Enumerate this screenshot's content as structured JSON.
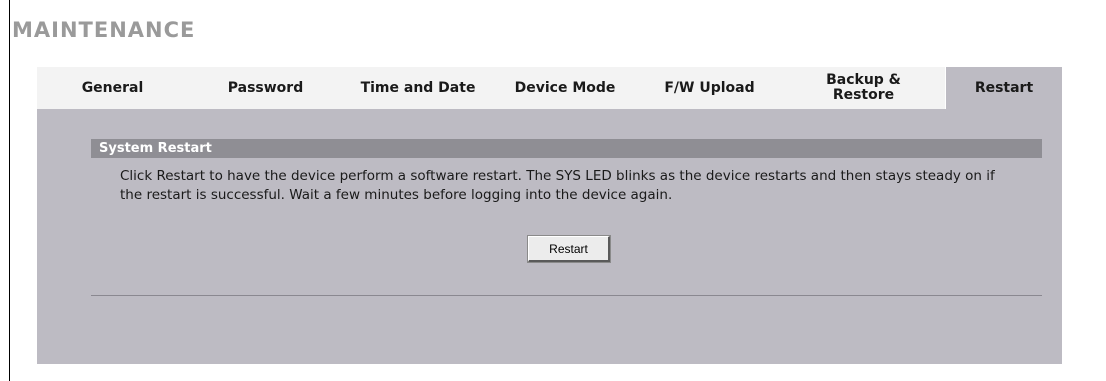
{
  "page": {
    "title": "MAINTENANCE"
  },
  "tabs": [
    {
      "label": "General",
      "active": false
    },
    {
      "label": "Password",
      "active": false
    },
    {
      "label": "Time and Date",
      "active": false
    },
    {
      "label": "Device Mode",
      "active": false
    },
    {
      "label": "F/W Upload",
      "active": false
    },
    {
      "label": "Backup &\nRestore",
      "active": false
    },
    {
      "label": "Restart",
      "active": true
    }
  ],
  "section": {
    "title": "System Restart",
    "description": "Click Restart to have the device perform a software restart. The SYS LED blinks as the device restarts and then stays steady on if the restart is successful. Wait a few minutes before logging into the device again.",
    "button_label": "Restart"
  },
  "colors": {
    "panel": "#bdbbc3",
    "tabbar": "#f3f3f3",
    "section_header": "#8f8e94",
    "title": "#9a9a9a"
  }
}
